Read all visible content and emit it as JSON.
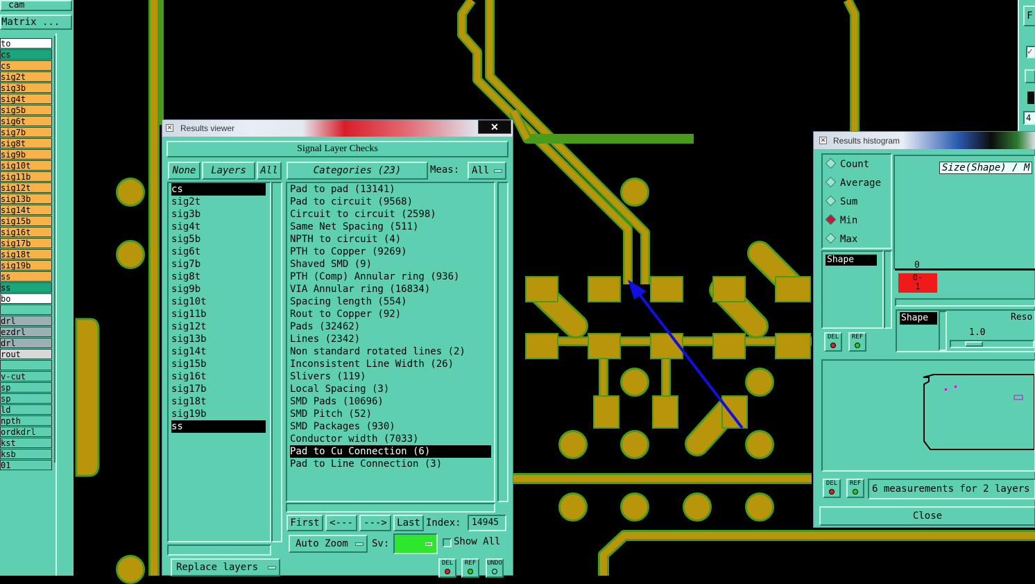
{
  "left_panel": {
    "cam_label": "cam",
    "matrix_button": "Matrix ...",
    "layers": [
      {
        "label": "to",
        "color": "#ffffff"
      },
      {
        "label": "cs",
        "color": "#1aa57d"
      },
      {
        "label": "cs",
        "color": "#f7b24a"
      },
      {
        "label": "sig2t",
        "color": "#f7b24a"
      },
      {
        "label": "sig3b",
        "color": "#f7b24a"
      },
      {
        "label": "sig4t",
        "color": "#f7b24a"
      },
      {
        "label": "sig5b",
        "color": "#f7b24a"
      },
      {
        "label": "sig6t",
        "color": "#f7b24a"
      },
      {
        "label": "sig7b",
        "color": "#f7b24a"
      },
      {
        "label": "sig8t",
        "color": "#f7b24a"
      },
      {
        "label": "sig9b",
        "color": "#f7b24a"
      },
      {
        "label": "sig10t",
        "color": "#f7b24a"
      },
      {
        "label": "sig11b",
        "color": "#f7b24a"
      },
      {
        "label": "sig12t",
        "color": "#f7b24a"
      },
      {
        "label": "sig13b",
        "color": "#f7b24a"
      },
      {
        "label": "sig14t",
        "color": "#f7b24a"
      },
      {
        "label": "sig15b",
        "color": "#f7b24a"
      },
      {
        "label": "sig16t",
        "color": "#f7b24a"
      },
      {
        "label": "sig17b",
        "color": "#f7b24a"
      },
      {
        "label": "sig18t",
        "color": "#f7b24a"
      },
      {
        "label": "sig19b",
        "color": "#f7b24a"
      },
      {
        "label": "ss",
        "color": "#f7b24a"
      },
      {
        "label": "ss",
        "color": "#1aa57d"
      },
      {
        "label": "bo",
        "color": "#ffffff"
      },
      {
        "label": "",
        "color": "#5fcfb2"
      },
      {
        "label": "drl",
        "color": "#9bb0b3"
      },
      {
        "label": "ezdrl",
        "color": "#9bb0b3"
      },
      {
        "label": "drl",
        "color": "#9bb0b3"
      },
      {
        "label": "rout",
        "color": "#d8d8d8"
      },
      {
        "label": "",
        "color": "#5fcfb2"
      },
      {
        "label": "v-cut",
        "color": "#5fcfb2"
      },
      {
        "label": "sp",
        "color": "#5fcfb2"
      },
      {
        "label": "sp",
        "color": "#5fcfb2"
      },
      {
        "label": "ld",
        "color": "#5fcfb2"
      },
      {
        "label": "npth",
        "color": "#5fcfb2"
      },
      {
        "label": "ordkdrl",
        "color": "#5fcfb2"
      },
      {
        "label": "kst",
        "color": "#5fcfb2"
      },
      {
        "label": "ksb",
        "color": "#5fcfb2"
      },
      {
        "label": "01",
        "color": "#5fcfb2"
      }
    ]
  },
  "results_viewer": {
    "window_title": "Results viewer",
    "close_glyph": "✕",
    "header": "Signal Layer Checks",
    "none_btn": "None",
    "layers_btn": "Layers",
    "all_btn": "All",
    "categories_btn": "Categories (23)",
    "meas_label": "Meas:",
    "meas_value": "All",
    "layers": [
      "cs",
      "sig2t",
      "sig3b",
      "sig4t",
      "sig5b",
      "sig6t",
      "sig7b",
      "sig8t",
      "sig9b",
      "sig10t",
      "sig11b",
      "sig12t",
      "sig13b",
      "sig14t",
      "sig15b",
      "sig16t",
      "sig17b",
      "sig18t",
      "sig19b",
      "ss"
    ],
    "selected_layers": [
      "cs",
      "ss"
    ],
    "categories": [
      "Pad to pad (13141)",
      "Pad to circuit (9568)",
      "Circuit to circuit (2598)",
      "Same Net Spacing (511)",
      "NPTH to circuit (4)",
      "PTH to Copper (9269)",
      "Shaved SMD (9)",
      "PTH (Comp) Annular ring (936)",
      "VIA Annular ring (16834)",
      "Spacing length (554)",
      "Rout to Copper (92)",
      "Pads (32462)",
      "Lines (2342)",
      "Non standard rotated lines (2)",
      "Inconsistent Line Width (26)",
      "Slivers (119)",
      "Local Spacing (3)",
      "SMD Pads (10696)",
      "SMD Pitch (52)",
      "SMD Packages (930)",
      "Conductor width (7033)",
      "Pad to Cu Connection (6)",
      "Pad to Line Connection (3)"
    ],
    "selected_category": "Pad to Cu Connection (6)",
    "first_btn": "First",
    "prev_btn": "<---",
    "next_btn": "--->",
    "last_btn": "Last",
    "index_label": "Index:",
    "index_value": "14945",
    "auto_zoom": "Auto Zoom",
    "sv_label": "Sv:",
    "show_all": "Show All",
    "replace_layers": "Replace layers",
    "del_btn": "DEL",
    "ref_btn": "REF",
    "undo_btn": "UNDO"
  },
  "histogram": {
    "window_title": "Results histogram",
    "options": [
      "Count",
      "Average",
      "Sum",
      "Min",
      "Max"
    ],
    "selected_option": "Min",
    "shape_label": "Shape",
    "axis_title": "Size(Shape) / M",
    "zero_label": "0",
    "bin_label_1": "0-",
    "bin_label_2": "1",
    "shape_label_2": "Shape",
    "reso_label": "Reso",
    "reso_value": "1.0",
    "del_btn": "DEL",
    "ref_btn": "REF",
    "status": "6 measurements for 2 layers",
    "close_btn": "Close"
  },
  "right_edge": {
    "top_letter": "F",
    "number": "4"
  },
  "colors": {
    "copper": "#b8950a",
    "copper_edge": "#4a9a1c",
    "panel": "#5fcfb2",
    "arrow": "#1010e0"
  }
}
